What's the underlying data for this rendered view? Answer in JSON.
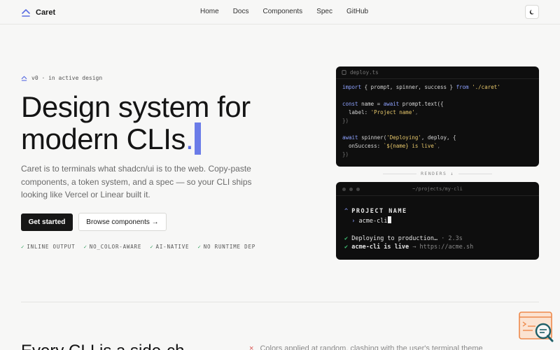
{
  "brand": {
    "name": "Caret",
    "icon": "caret-up-icon"
  },
  "nav": {
    "links": [
      "Home",
      "Docs",
      "Components",
      "Spec",
      "GitHub"
    ],
    "theme_icon": "moon-icon"
  },
  "hero": {
    "badge": "v0 · in active design",
    "title_line1": "Design system for",
    "title_line2": "modern CLIs",
    "title_dot": ".",
    "description": "Caret is to terminals what shadcn/ui is to the web. Copy-paste components, a token system, and a spec — so your CLI ships looking like Vercel or Linear built it.",
    "primary_button": "Get started",
    "secondary_button": "Browse components →",
    "features": [
      "INLINE OUTPUT",
      "NO_COLOR-AWARE",
      "AI-NATIVE",
      "NO RUNTIME DEP"
    ],
    "feature_mark": "✓"
  },
  "code": {
    "filename": "deploy.ts",
    "lines": {
      "l1_kw": "import",
      "l1_names": " { prompt, spinner, success } ",
      "l1_from": "from",
      "l1_path": " './caret'",
      "l3_kw": "const",
      "l3_name": " name = ",
      "l3_await": "await",
      "l3_call": " prompt.text({",
      "l4_key": "  label: ",
      "l4_val": "'Project name'",
      "l4_end": ",",
      "l5": "})",
      "l7_await": "await",
      "l7_call": " spinner(",
      "l7_str": "'Deploying'",
      "l7_end": ", deploy, {",
      "l8_key": "  onSuccess: ",
      "l8_val": "`${name} is live`",
      "l8_end": ",",
      "l9": "})"
    }
  },
  "renders_label": "RENDERS ↓",
  "terminal": {
    "path": "~/projects/my-cli",
    "prompt_mark": "^",
    "prompt_label": "PROJECT NAME",
    "input_mark": "›",
    "input_value": "acme-cli",
    "check": "✔",
    "line1": "Deploying to production…",
    "line1_time": " · 2.3s",
    "line2": "acme-cli is live",
    "line2_arrow": " → ",
    "line2_url": "https://acme.sh"
  },
  "lower": {
    "heading": "Every CLI is a side-ch",
    "item_mark": "×",
    "item": "Colors applied at random, clashing with the user's terminal theme"
  },
  "colors": {
    "accent": "#5b6ee1",
    "panel": "#0e0e0e",
    "success": "#3fbf74"
  }
}
